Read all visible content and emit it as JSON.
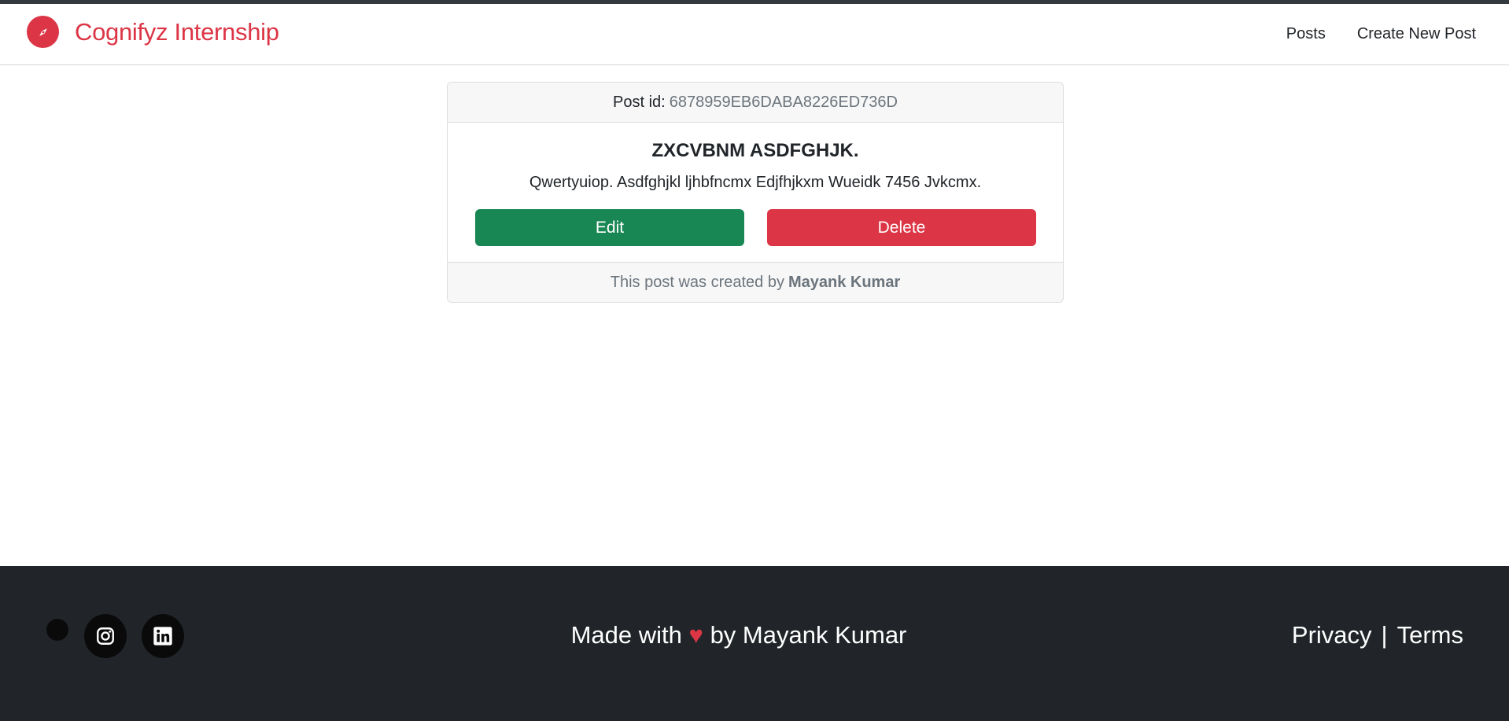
{
  "navbar": {
    "brand": "Cognifyz Internship",
    "links": [
      "Posts",
      "Create New Post"
    ]
  },
  "post": {
    "id_label": "Post id:",
    "id_value": "6878959EB6DABA8226ED736D",
    "title": "ZXCVBNM ASDFGHJK.",
    "body": "Qwertyuiop. Asdfghjkl ljhbfncmx Edjfhjkxm Wueidk 7456 Jvkcmx.",
    "edit_label": "Edit",
    "delete_label": "Delete",
    "footer_prefix": "This post was created by",
    "author": "Mayank Kumar"
  },
  "footer": {
    "made_prefix": "Made with",
    "heart": "♥",
    "made_suffix": "by Mayank Kumar",
    "privacy": "Privacy",
    "separator": "|",
    "terms": "Terms",
    "icons": [
      "instagram-icon",
      "linkedin-icon"
    ]
  },
  "colors": {
    "brand": "#dc3545",
    "edit": "#198754",
    "delete": "#dc3545",
    "footer_bg": "#212529"
  }
}
